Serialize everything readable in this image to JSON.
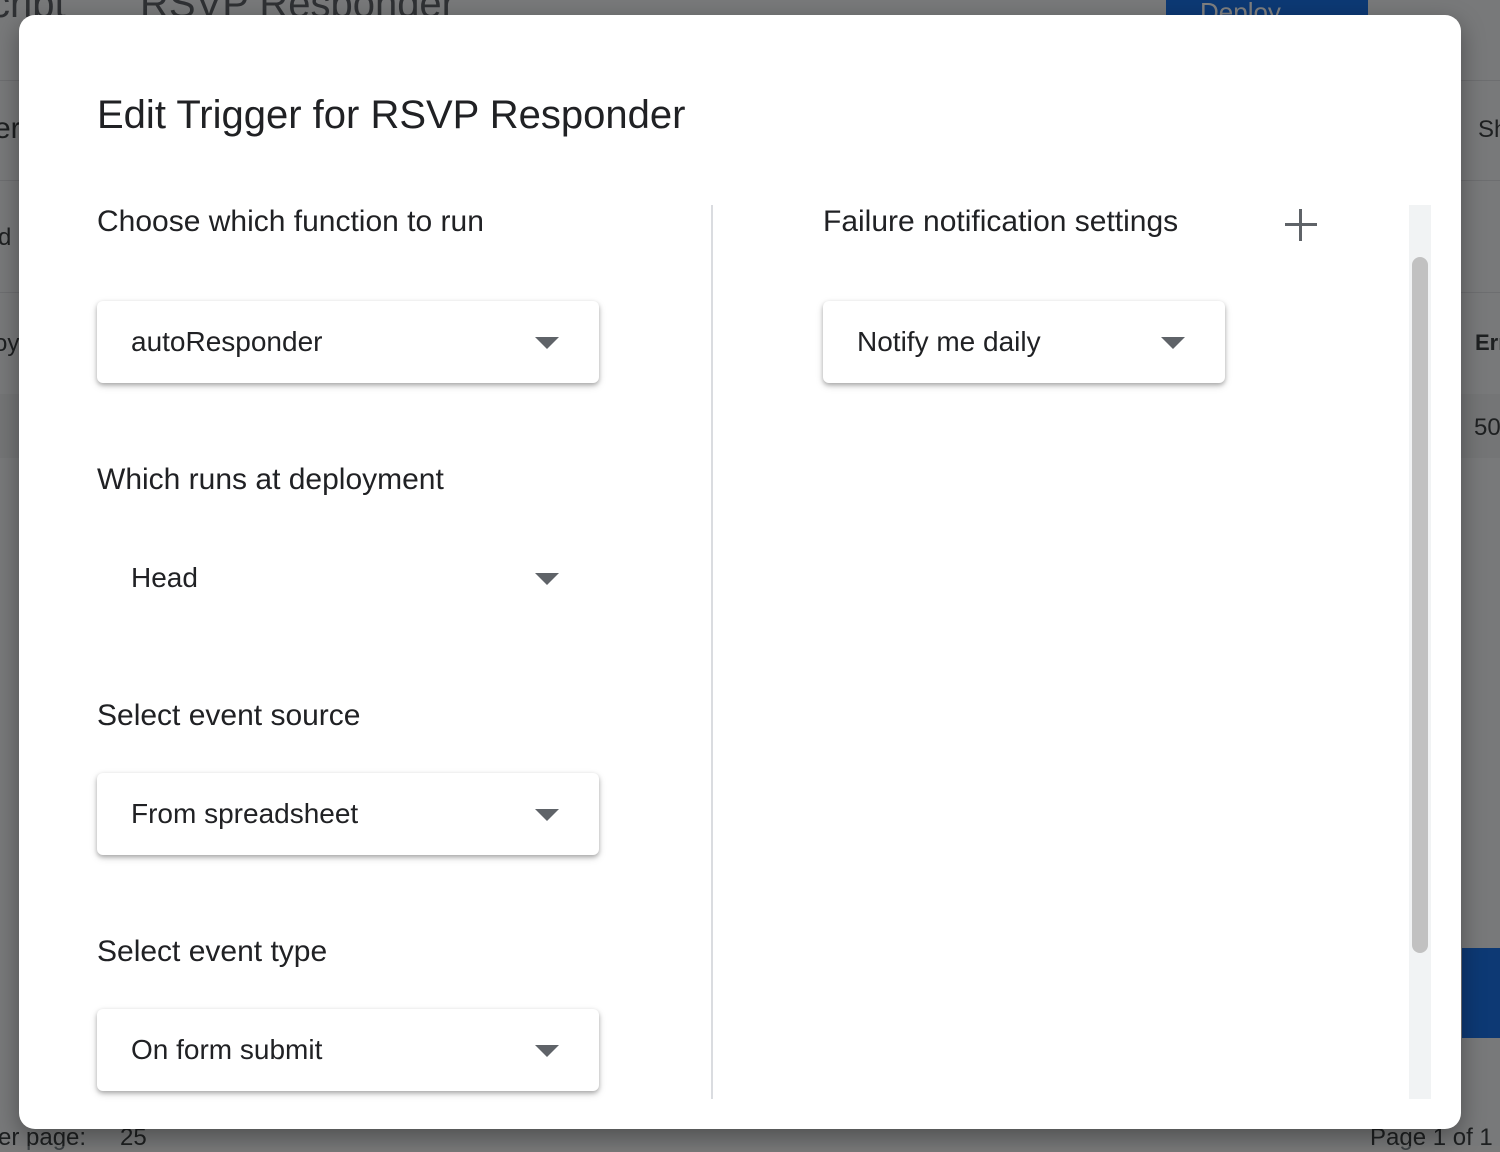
{
  "background": {
    "app_name": "cript",
    "project_title": "RSVP Responder",
    "deploy_label": "Deploy",
    "side_fragments": [
      "er",
      "d",
      "oy"
    ],
    "right_fragments": [
      "Sh",
      "Err",
      "50"
    ],
    "rows_per_page_label": "er page:",
    "rows_per_page_value": "25",
    "page_info": "Page 1 of 1"
  },
  "dialog": {
    "title": "Edit Trigger for RSVP Responder",
    "function_label": "Choose which function to run",
    "function_value": "autoResponder",
    "deployment_label": "Which runs at deployment",
    "deployment_value": "Head",
    "event_source_label": "Select event source",
    "event_source_value": "From spreadsheet",
    "event_type_label": "Select event type",
    "event_type_value": "On form submit",
    "failure_label": "Failure notification settings",
    "failure_value": "Notify me daily",
    "add_icon": "plus-icon"
  }
}
